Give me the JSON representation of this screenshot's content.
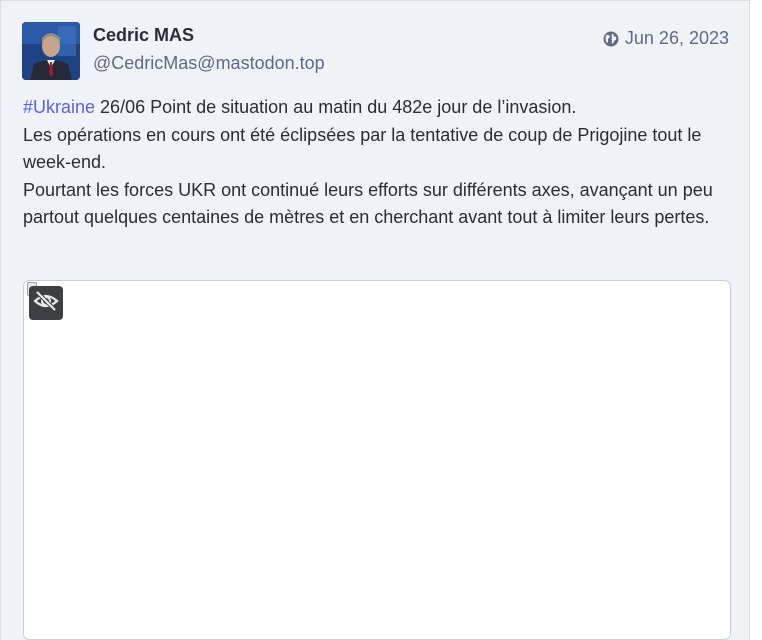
{
  "post": {
    "display_name": "Cedric MAS",
    "handle": "@CedricMas@mastodon.top",
    "date": "Jun 26, 2023",
    "visibility_icon": "globe-icon",
    "hashtag": "#Ukraine",
    "paragraph_1_rest": " 26/06 Point de situation au matin du 482e jour de l’invasion.",
    "paragraph_2": "Les opérations en cours ont été éclipsées par la tentative de coup de Prigojine tout le week-end.",
    "paragraph_3": "Pourtant les forces UKR ont continué leurs efforts sur différents axes, avançant un peu partout quelques centaines de mètres et en cherchant avant tout à limiter leurs pertes."
  },
  "media": {
    "hide_icon": "eye-slash-icon"
  },
  "colors": {
    "background": "#eff3f8",
    "hashtag": "#5c62d8",
    "text": "#282c37",
    "muted": "#606984"
  }
}
